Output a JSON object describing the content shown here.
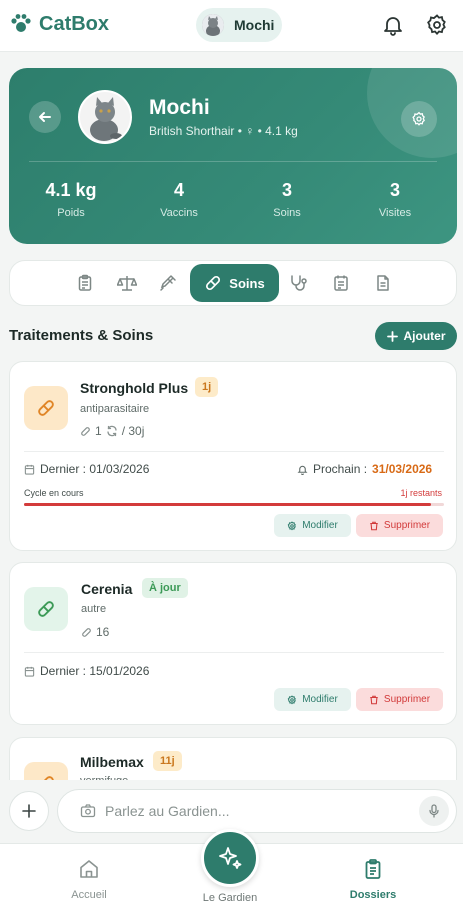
{
  "app": {
    "name": "CatBox"
  },
  "header": {
    "pet_chip_name": "Mochi",
    "icons": [
      "bell-icon",
      "gear-icon"
    ]
  },
  "pet": {
    "name": "Mochi",
    "subtitle": "British Shorthair • ♀ • 4.1 kg",
    "stats": [
      {
        "value": "4.1 kg",
        "label": "Poids"
      },
      {
        "value": "4",
        "label": "Vaccins"
      },
      {
        "value": "3",
        "label": "Soins"
      },
      {
        "value": "3",
        "label": "Visites"
      }
    ]
  },
  "tabs": {
    "icons": [
      "clipboard-icon",
      "scale-icon",
      "syringe-icon",
      "pill-icon",
      "stethoscope-icon",
      "calendar-icon",
      "document-icon"
    ],
    "active_label": "Soins"
  },
  "section": {
    "title": "Traitements & Soins",
    "add_label": "Ajouter"
  },
  "treatments": [
    {
      "name": "Stronghold Plus",
      "badge": "1j",
      "type": "antiparasitaire",
      "doses": "1",
      "cycle": "/ 30j",
      "last": "Dernier : 01/03/2026",
      "next_label": "Prochain :",
      "next_date": "31/03/2026",
      "cycle_label": "Cycle en cours",
      "remaining": "1j restants",
      "progress": 0.97,
      "edit_label": "Modifier",
      "delete_label": "Supprimer"
    },
    {
      "name": "Cerenia",
      "badge": "À jour",
      "type": "autre",
      "doses": "16",
      "last": "Dernier : 15/01/2026",
      "edit_label": "Modifier",
      "delete_label": "Supprimer"
    },
    {
      "name": "Milbemax",
      "badge": "11j",
      "type": "vermifuge"
    }
  ],
  "chat": {
    "placeholder": "Parlez au Gardien..."
  },
  "nav": {
    "home": "Accueil",
    "center": "Le Gardien",
    "files": "Dossiers"
  },
  "colors": {
    "primary": "#2e7c6c",
    "warning": "#d86a16",
    "danger": "#d33b3b"
  }
}
